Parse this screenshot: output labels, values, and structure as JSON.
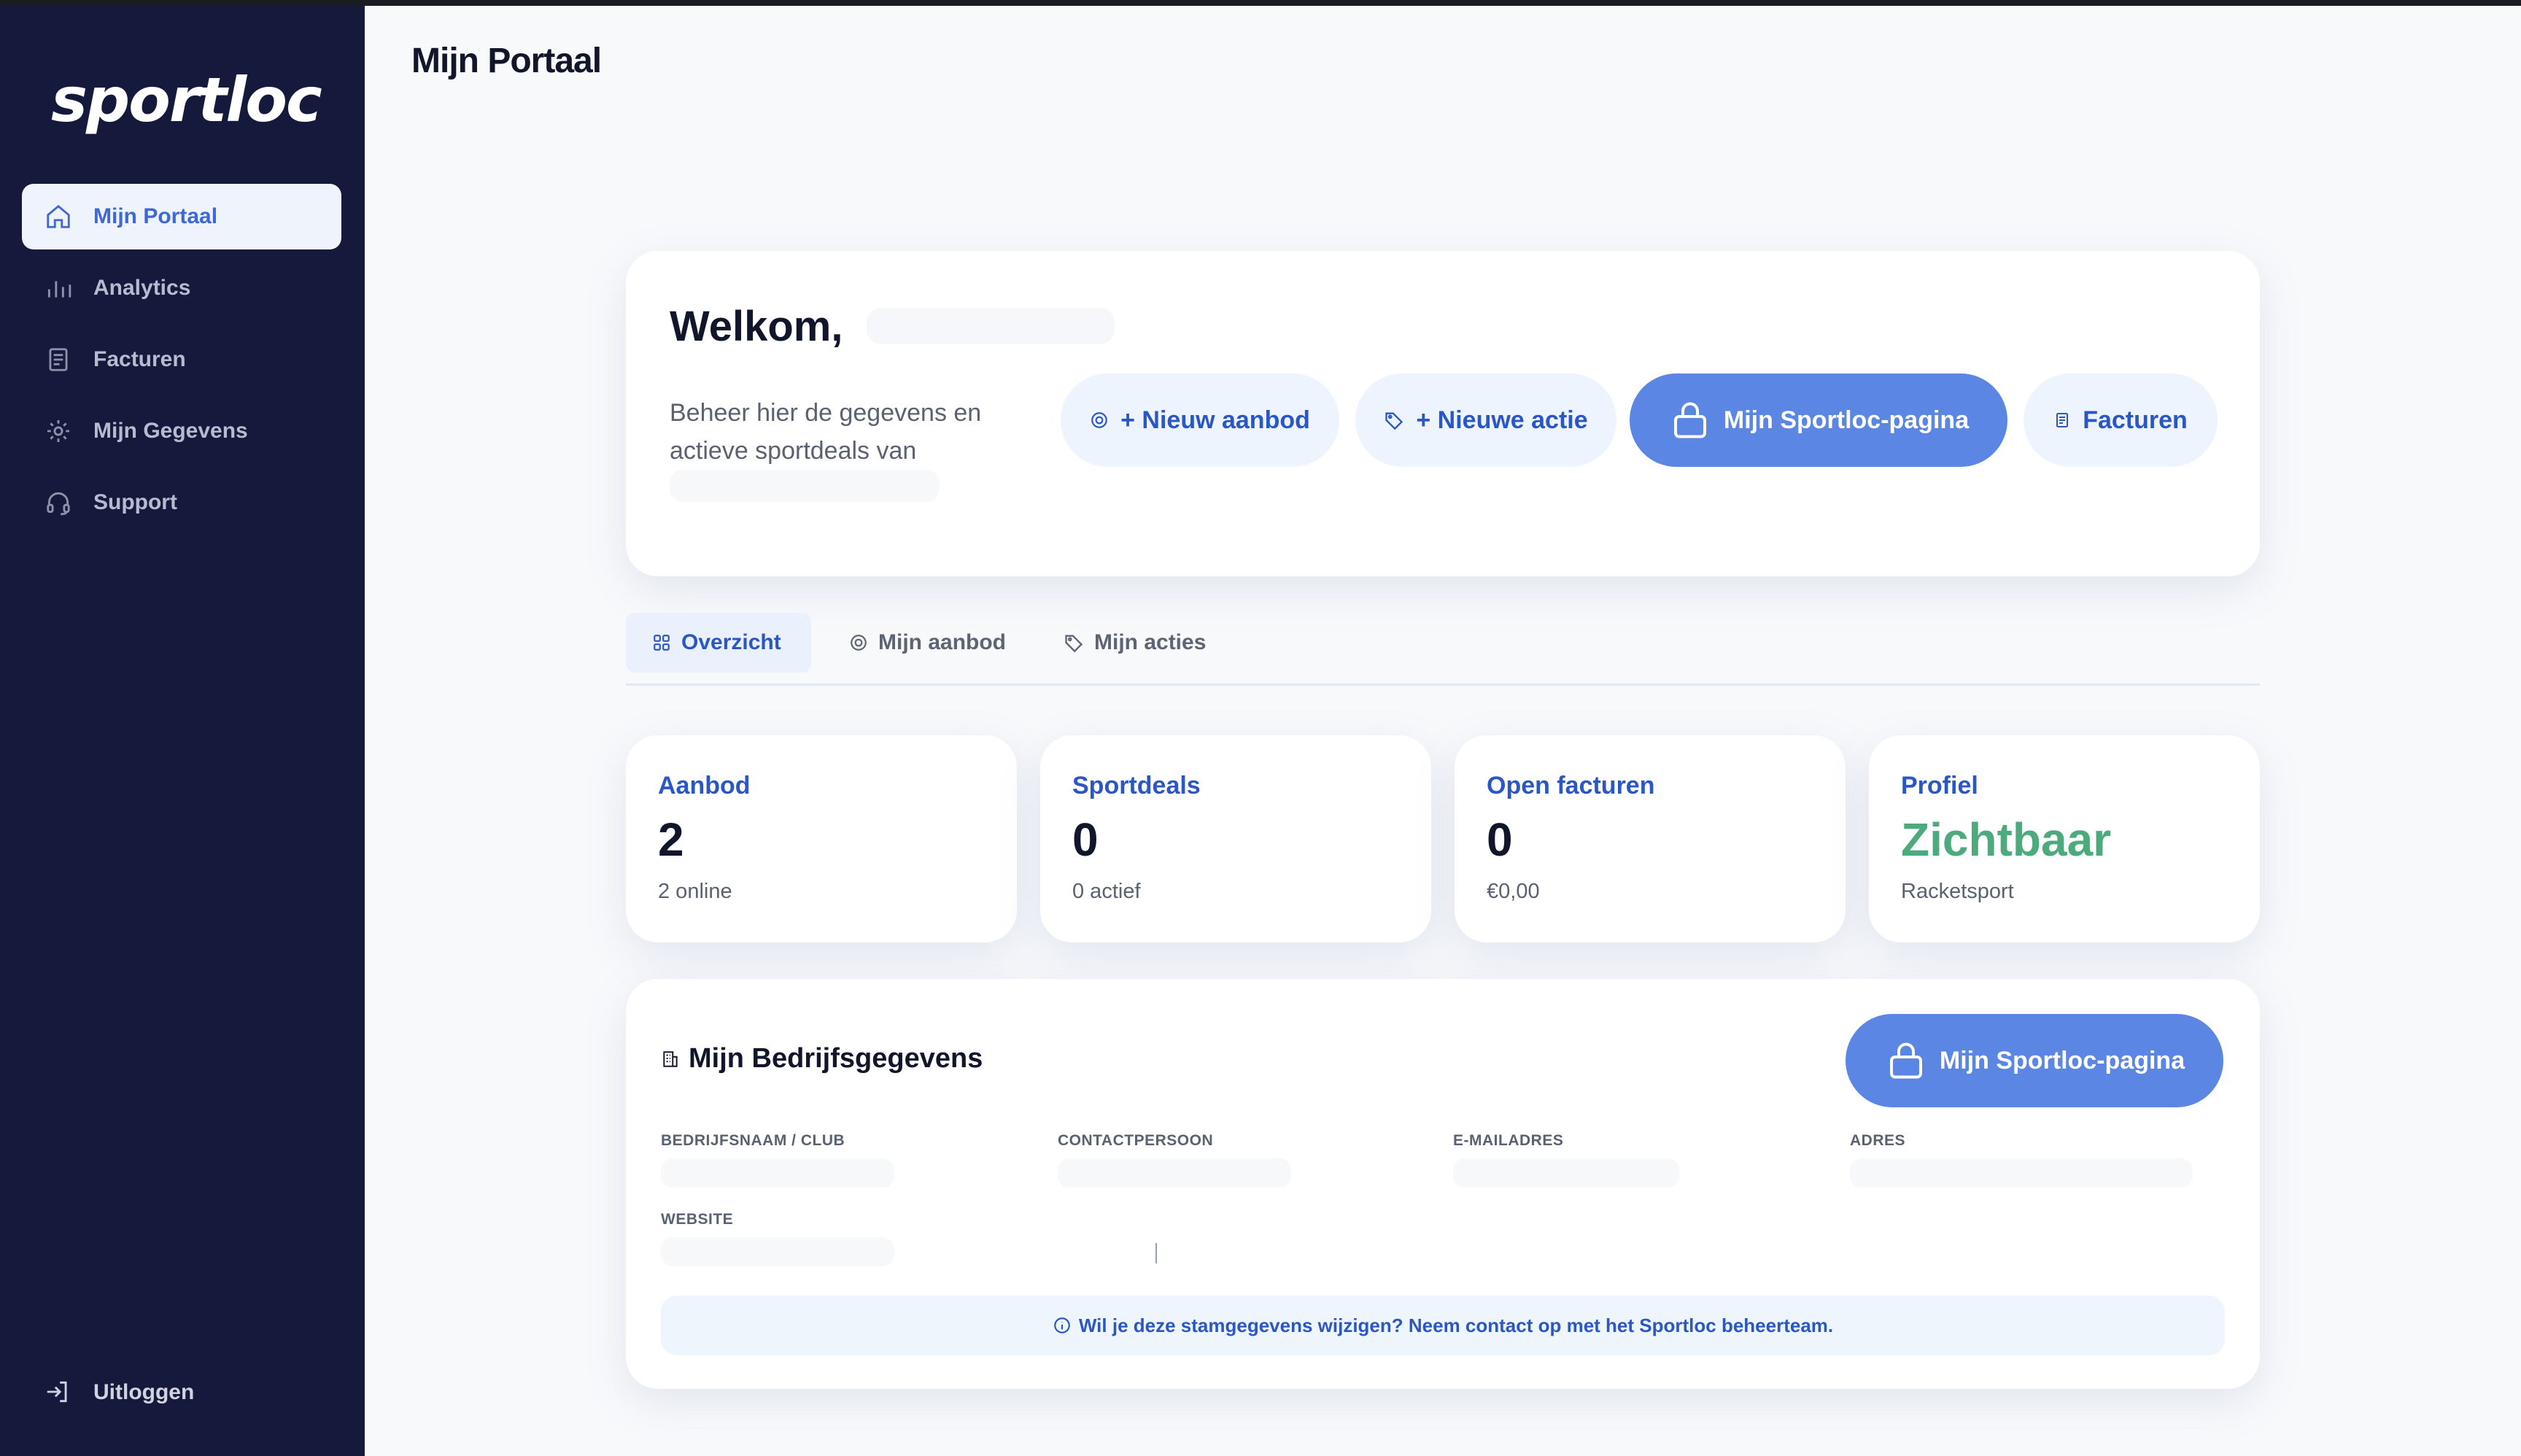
{
  "brand": {
    "logo_text": "sportloc",
    "accent": "#3f67d9",
    "sidebar_bg": "#15193b",
    "primary_button": "#5b86e4",
    "success": "#4daa7c"
  },
  "sidebar": {
    "items": [
      {
        "label": "Mijn Portaal",
        "icon": "home-icon",
        "active": true
      },
      {
        "label": "Analytics",
        "icon": "bar-chart-icon",
        "active": false
      },
      {
        "label": "Facturen",
        "icon": "receipt-icon",
        "active": false
      },
      {
        "label": "Mijn Gegevens",
        "icon": "gear-icon",
        "active": false
      },
      {
        "label": "Support",
        "icon": "headset-icon",
        "active": false
      }
    ],
    "logout_label": "Uitloggen"
  },
  "header": {
    "title": "Mijn Portaal"
  },
  "welcome": {
    "title": "Welkom,",
    "description": "Beheer hier de gegevens en actieve sportdeals van",
    "buttons": {
      "new_offer": "+ Nieuw aanbod",
      "new_action": "+ Nieuwe actie",
      "my_page": "Mijn Sportloc-pagina",
      "invoices": "Facturen"
    }
  },
  "tabs": [
    {
      "label": "Overzicht",
      "icon": "grid-icon",
      "active": true
    },
    {
      "label": "Mijn aanbod",
      "icon": "target-icon",
      "active": false
    },
    {
      "label": "Mijn acties",
      "icon": "tag-icon",
      "active": false
    }
  ],
  "stats": [
    {
      "label": "Aanbod",
      "value": "2",
      "sub": "2 online"
    },
    {
      "label": "Sportdeals",
      "value": "0",
      "sub": "0 actief"
    },
    {
      "label": "Open facturen",
      "value": "0",
      "sub": "€0,00"
    },
    {
      "label": "Profiel",
      "value": "Zichtbaar",
      "sub": "Racketsport"
    }
  ],
  "company": {
    "title": "Mijn Bedrijfsgegevens",
    "cta": "Mijn Sportloc-pagina",
    "fields": {
      "name": "BEDRIJFSNAAM / CLUB",
      "contact": "CONTACTPERSOON",
      "email": "E-MAILADRES",
      "address": "ADRES",
      "website": "WEBSITE"
    },
    "notice": "Wil je deze stamgegevens wijzigen? Neem contact op met het Sportloc beheerteam."
  }
}
